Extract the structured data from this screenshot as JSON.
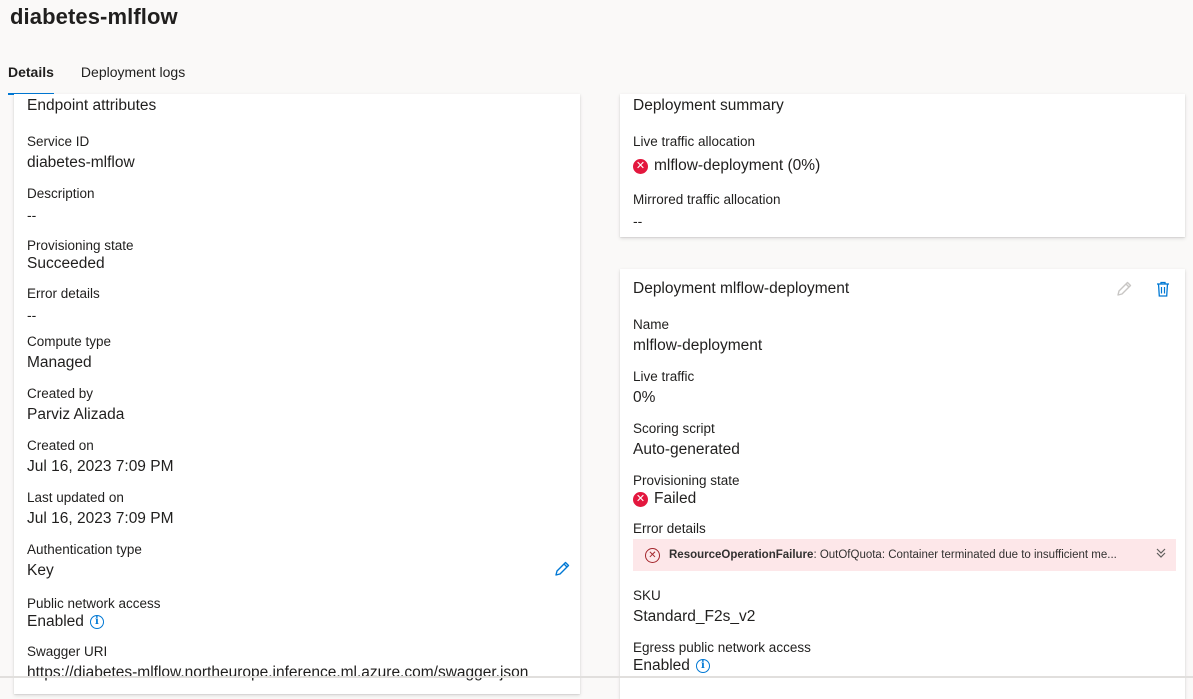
{
  "page": {
    "title": "diabetes-mlflow"
  },
  "tabs": [
    {
      "label": "Details",
      "active": true
    },
    {
      "label": "Deployment logs",
      "active": false
    }
  ],
  "endpoint": {
    "title": "Endpoint attributes",
    "fields": {
      "service_id": {
        "label": "Service ID",
        "value": "diabetes-mlflow"
      },
      "description": {
        "label": "Description",
        "value": "--"
      },
      "provisioning_state": {
        "label": "Provisioning state",
        "value": "Succeeded"
      },
      "error_details": {
        "label": "Error details",
        "value": "--"
      },
      "compute_type": {
        "label": "Compute type",
        "value": "Managed"
      },
      "created_by": {
        "label": "Created by",
        "value": "Parviz Alizada"
      },
      "created_on": {
        "label": "Created on",
        "value": "Jul 16, 2023 7:09 PM"
      },
      "last_updated_on": {
        "label": "Last updated on",
        "value": "Jul 16, 2023 7:09 PM"
      },
      "auth_type": {
        "label": "Authentication type",
        "value": "Key"
      },
      "public_network_access": {
        "label": "Public network access",
        "value": "Enabled"
      },
      "swagger_uri": {
        "label": "Swagger URI",
        "value": "https://diabetes-mlflow.northeurope.inference.ml.azure.com/swagger.json"
      }
    }
  },
  "summary": {
    "title": "Deployment summary",
    "live_traffic": {
      "label": "Live traffic allocation",
      "value": "mlflow-deployment (0%)"
    },
    "mirrored_traffic": {
      "label": "Mirrored traffic allocation",
      "value": "--"
    }
  },
  "deployment": {
    "title": "Deployment mlflow-deployment",
    "fields": {
      "name": {
        "label": "Name",
        "value": "mlflow-deployment"
      },
      "live_traffic": {
        "label": "Live traffic",
        "value": "0%"
      },
      "scoring_script": {
        "label": "Scoring script",
        "value": "Auto-generated"
      },
      "provisioning_state": {
        "label": "Provisioning state",
        "value": "Failed"
      },
      "error_details": {
        "label": "Error details",
        "error_code": "ResourceOperationFailure",
        "error_message": ": OutOfQuota: Container terminated due to insufficient me..."
      },
      "sku": {
        "label": "SKU",
        "value": "Standard_F2s_v2"
      },
      "egress": {
        "label": "Egress public network access",
        "value": "Enabled"
      }
    }
  },
  "colors": {
    "accent": "#0078d4",
    "error": "#e3173e",
    "error_bg": "#fde7e9"
  },
  "icons": [
    "error-circle-icon",
    "info-icon",
    "edit-pencil-icon",
    "delete-trash-icon",
    "chevron-double-down-icon"
  ]
}
